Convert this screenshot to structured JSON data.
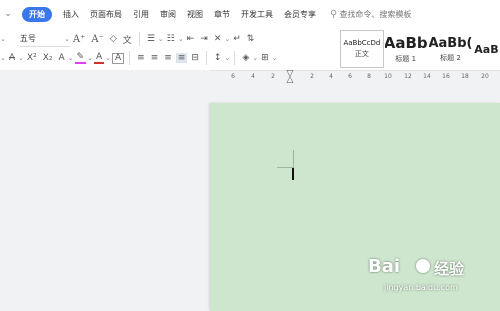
{
  "menubar": {
    "caret_icon": "chevron-down-icon",
    "tabs": [
      {
        "label": "开始",
        "active": true
      },
      {
        "label": "插入"
      },
      {
        "label": "页面布局"
      },
      {
        "label": "引用"
      },
      {
        "label": "审阅"
      },
      {
        "label": "视图"
      },
      {
        "label": "章节"
      },
      {
        "label": "开发工具"
      },
      {
        "label": "会员专享"
      }
    ],
    "search_placeholder": "查找命令、搜索模板"
  },
  "toolbar": {
    "font_size": "五号",
    "grow_font": "A⁺",
    "shrink_font": "A⁻",
    "clear_format": "◇",
    "phonetic": "文",
    "strikethrough": "A",
    "superscript": "X²",
    "subscript": "X₂",
    "text_effect": "A",
    "highlight": "✎",
    "font_color": "A",
    "char_border": "A"
  },
  "styles": {
    "items": [
      {
        "preview": "AaBbCcDd",
        "name": "正文"
      },
      {
        "preview": "AaBb",
        "name": "标题 1"
      },
      {
        "preview": "AaBb(",
        "name": "标题 2"
      },
      {
        "preview": "AaB",
        "name": ""
      }
    ]
  },
  "ruler": {
    "ticks": [
      "6",
      "4",
      "2",
      "2",
      "4",
      "6",
      "8",
      "10",
      "12",
      "14",
      "16",
      "18",
      "20"
    ]
  },
  "watermark": {
    "logo": "Bai",
    "logo_cn": "经验",
    "url": "jingyan.baidu.com"
  },
  "colors": {
    "accent": "#3a77ec",
    "page_background": "#cde6cd",
    "workspace": "#f1f2f4"
  }
}
